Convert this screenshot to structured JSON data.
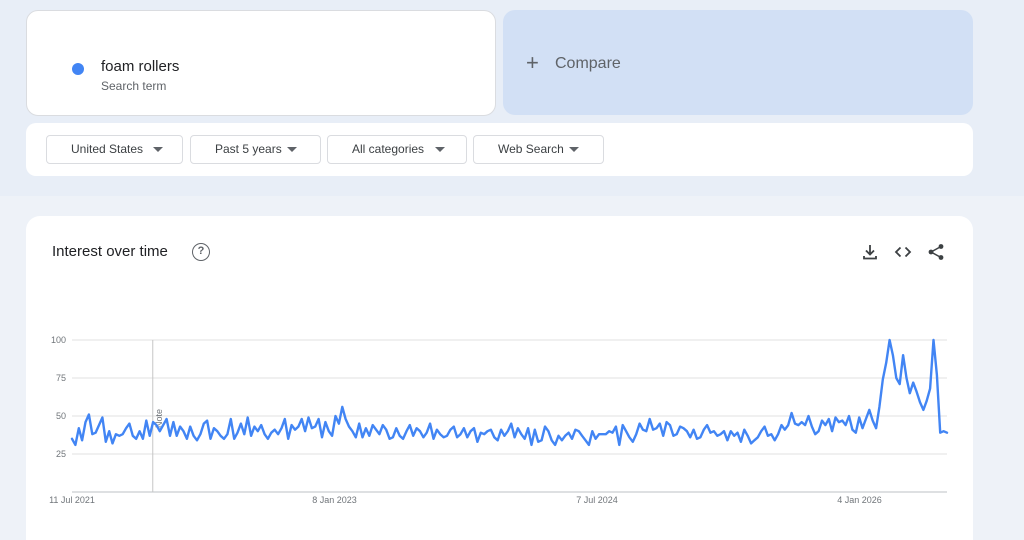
{
  "colors": {
    "series": "#4285f4",
    "dot": "#4285f4"
  },
  "search_term": {
    "name": "foam rollers",
    "subtitle": "Search term"
  },
  "compare": {
    "plus": "+",
    "label": "Compare"
  },
  "filters": [
    {
      "label": "United States"
    },
    {
      "label": "Past 5 years"
    },
    {
      "label": "All categories"
    },
    {
      "label": "Web Search"
    }
  ],
  "chart_panel": {
    "title": "Interest over time",
    "help_icon": "help-circle-icon",
    "tools": [
      "download-icon",
      "embed-code-icon",
      "share-icon"
    ]
  },
  "chart_data": {
    "type": "line",
    "ylim": [
      0,
      100
    ],
    "y_ticks": [
      25,
      50,
      75,
      100
    ],
    "x_ticks": [
      {
        "label": "11 Jul 2021",
        "date": "2021-07-11"
      },
      {
        "label": "8 Jan 2023",
        "date": "2023-01-08"
      },
      {
        "label": "7 Jul 2024",
        "date": "2024-07-07"
      },
      {
        "label": "4 Jan 2026",
        "date": "2026-01-04"
      }
    ],
    "x_range": [
      "2021-07-11",
      "2026-07-05"
    ],
    "annotations": [
      {
        "label": "Note",
        "date": "2021-12-26"
      }
    ],
    "series": [
      {
        "values": [
          35,
          31,
          42,
          34,
          46,
          51,
          38,
          39,
          44,
          49,
          33,
          40,
          32,
          38,
          37,
          38,
          42,
          45,
          37,
          35,
          40,
          35,
          47,
          37,
          46,
          44,
          40,
          44,
          48,
          37,
          46,
          37,
          43,
          40,
          35,
          43,
          37,
          34,
          38,
          45,
          47,
          35,
          42,
          40,
          37,
          35,
          38,
          48,
          35,
          39,
          45,
          38,
          49,
          37,
          43,
          40,
          44,
          38,
          35,
          39,
          41,
          38,
          42,
          48,
          35,
          44,
          41,
          43,
          48,
          40,
          49,
          42,
          43,
          48,
          36,
          46,
          40,
          37,
          50,
          45,
          56,
          48,
          43,
          40,
          36,
          45,
          36,
          42,
          37,
          44,
          41,
          38,
          44,
          41,
          35,
          36,
          42,
          37,
          35,
          40,
          44,
          37,
          42,
          40,
          36,
          39,
          45,
          35,
          41,
          38,
          36,
          37,
          41,
          43,
          36,
          38,
          42,
          36,
          40,
          42,
          33,
          39,
          38,
          40,
          41,
          36,
          34,
          41,
          37,
          40,
          45,
          36,
          42,
          38,
          35,
          42,
          31,
          41,
          33,
          34,
          43,
          40,
          34,
          31,
          37,
          34,
          37,
          39,
          35,
          41,
          40,
          37,
          34,
          31,
          40,
          35,
          38,
          38,
          38,
          40,
          39,
          43,
          31,
          44,
          40,
          36,
          33,
          38,
          45,
          41,
          40,
          48,
          41,
          42,
          45,
          37,
          46,
          44,
          37,
          38,
          43,
          42,
          40,
          36,
          41,
          35,
          36,
          41,
          44,
          39,
          40,
          37,
          38,
          40,
          34,
          40,
          37,
          39,
          33,
          41,
          37,
          32,
          34,
          36,
          40,
          43,
          37,
          38,
          34,
          38,
          44,
          41,
          44,
          52,
          45,
          44,
          46,
          44,
          50,
          43,
          38,
          40,
          47,
          44,
          48,
          40,
          49,
          46,
          47,
          44,
          50,
          41,
          39,
          49,
          42,
          48,
          54,
          47,
          42,
          56,
          74,
          85,
          100,
          90,
          75,
          71,
          90,
          75,
          65,
          72,
          66,
          59,
          54,
          60,
          68,
          100,
          77,
          39,
          40,
          39
        ]
      }
    ]
  }
}
